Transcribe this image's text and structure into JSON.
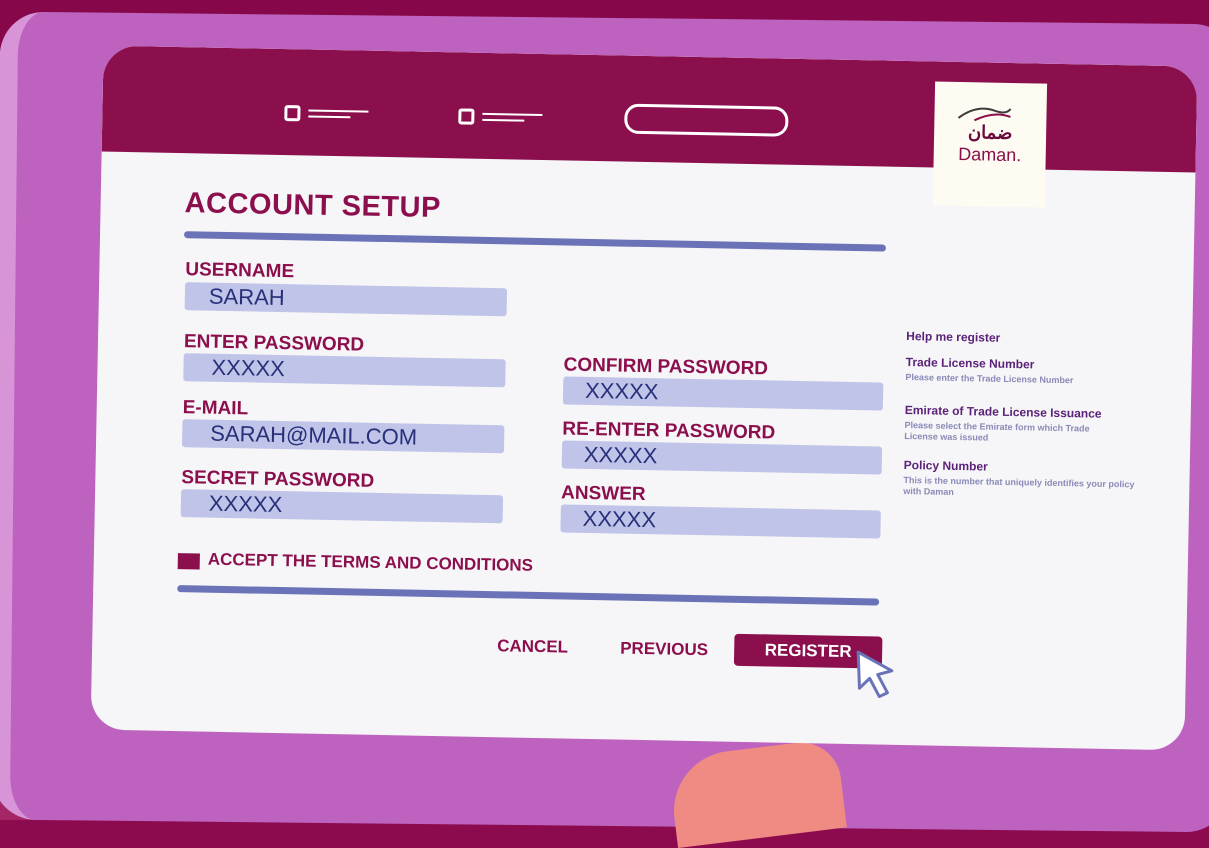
{
  "logo": {
    "arabic": "ضمان",
    "english": "Daman."
  },
  "form": {
    "title": "ACCOUNT SETUP",
    "username": {
      "label": "USERNAME",
      "value": "SARAH"
    },
    "enter_password": {
      "label": "ENTER PASSWORD",
      "value": "XXXXX"
    },
    "email": {
      "label": "E-MAIL",
      "value": "SARAH@MAIL.COM"
    },
    "secret_password": {
      "label": "SECRET PASSWORD",
      "value": "XXXXX"
    },
    "confirm_password": {
      "label": "CONFIRM PASSWORD",
      "value": "XXXXX"
    },
    "reenter_password": {
      "label": "RE-ENTER PASSWORD",
      "value": "XXXXX"
    },
    "answer": {
      "label": "ANSWER",
      "value": "XXXXX"
    },
    "accept_terms": "ACCEPT THE TERMS AND CONDITIONS"
  },
  "actions": {
    "cancel": "CANCEL",
    "previous": "PREVIOUS",
    "register": "REGISTER"
  },
  "help": {
    "heading": "Help me register",
    "items": [
      {
        "title": "Trade License Number",
        "text": "Please enter the Trade License Number"
      },
      {
        "title": "Emirate of Trade License Issuance",
        "text": "Please select the Emirate form which Trade License was issued"
      },
      {
        "title": "Policy Number",
        "text": "This is the number that uniquely identifies your policy with Daman"
      }
    ]
  },
  "colors": {
    "brand": "#8b0f4d",
    "field": "#bfc4e8",
    "rule": "#6a72b8",
    "device": "#bd62bf"
  }
}
